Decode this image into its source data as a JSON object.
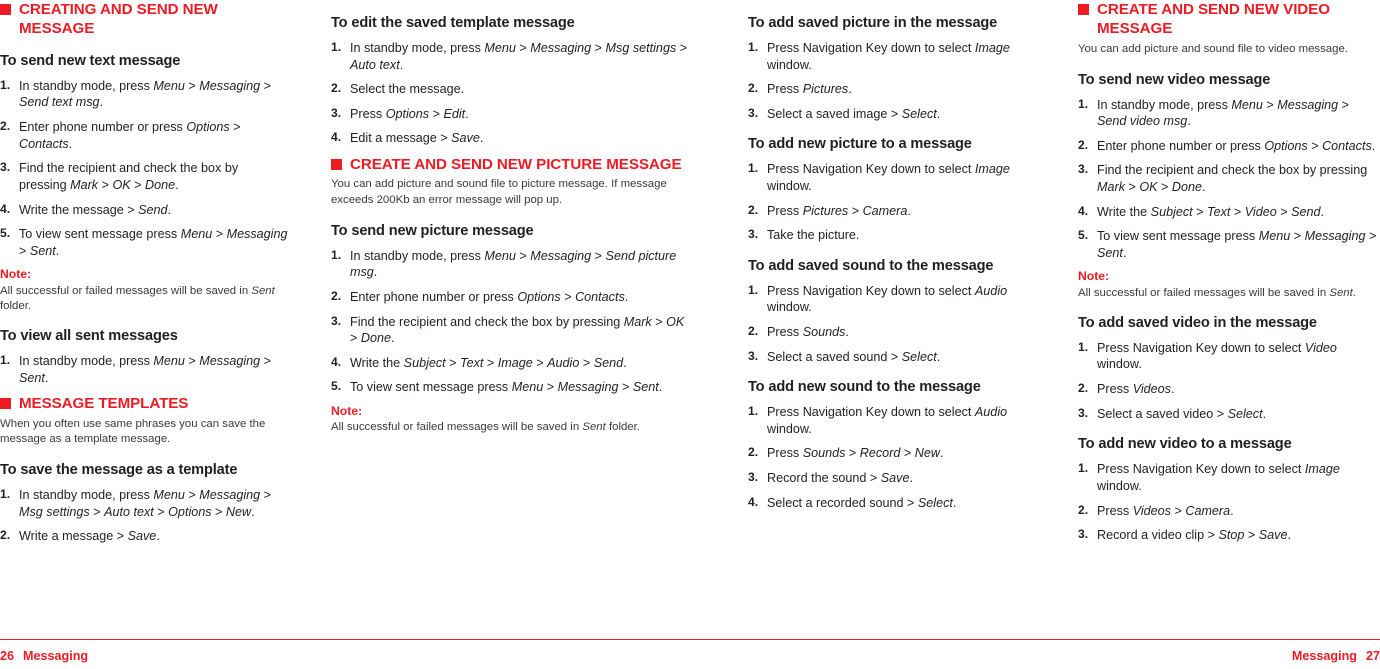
{
  "document": {
    "type": "mobile-phone-user-manual-spread",
    "accent_color": "#ec1c24",
    "text_color": "#231f20",
    "body_color": "#3a3a3c"
  },
  "footer": {
    "left_page_number": "26",
    "left_section": "Messaging",
    "right_section": "Messaging",
    "right_page_number": "27"
  },
  "columns": [
    {
      "id": "column-1",
      "blocks": [
        {
          "kind": "section-heading",
          "text": "CREATING AND SEND NEW MESSAGE"
        },
        {
          "kind": "sub-heading",
          "text": "To send new text message"
        },
        {
          "kind": "steps",
          "items": [
            "In standby mode, press <i>Menu</i> > <i>Messaging</i> > <i>Send text msg</i>.",
            "Enter phone number or press <i>Options</i> > <i>Contacts</i>.",
            "Find the recipient and check the box by pressing <i>Mark</i> > <i>OK</i> > <i>Done</i>.",
            "Write the message > <i>Send</i>.",
            "To view sent message press <i>Menu</i> > <i>Messaging</i> > <i>Sent</i>."
          ]
        },
        {
          "kind": "note",
          "label": "Note:",
          "body": "All successful or failed messages will be saved in <i>Sent</i> folder."
        },
        {
          "kind": "sub-heading",
          "text": "To view all sent messages"
        },
        {
          "kind": "steps",
          "items": [
            "In standby mode, press <i>Menu</i> > <i>Messaging</i> > <i>Sent</i>."
          ]
        },
        {
          "kind": "section-heading",
          "text": "MESSAGE TEMPLATES"
        },
        {
          "kind": "paragraph",
          "text": "When you often use same phrases you can save the message as a template message."
        },
        {
          "kind": "sub-heading",
          "text": "To save the message as a template"
        },
        {
          "kind": "steps",
          "items": [
            "In standby mode, press <i>Menu</i> > <i>Messaging</i> > <i>Msg settings</i> > <i>Auto text</i> > <i>Options</i> > <i>New</i>.",
            "Write a message > <i>Save</i>."
          ]
        }
      ]
    },
    {
      "id": "column-2",
      "blocks": [
        {
          "kind": "sub-heading",
          "text": "To edit the saved template message"
        },
        {
          "kind": "steps",
          "items": [
            "In standby mode, press <i>Menu</i> > <i>Messaging</i> > <i>Msg settings</i> > <i>Auto text</i>.",
            "Select the message.",
            "Press <i>Options</i> > <i>Edit</i>.",
            "Edit a message > <i>Save</i>."
          ]
        },
        {
          "kind": "section-heading",
          "text": "CREATE AND SEND NEW PICTURE MESSAGE"
        },
        {
          "kind": "paragraph",
          "text": "You can add picture and sound file to picture message. If message exceeds 200Kb an error message will pop up."
        },
        {
          "kind": "sub-heading",
          "text": "To send new picture message"
        },
        {
          "kind": "steps",
          "items": [
            "In standby mode, press <i>Menu</i> > <i>Messaging</i> > <i>Send picture msg</i>.",
            "Enter phone number or press <i>Options</i> > <i>Contacts</i>.",
            "Find the recipient and check the box by pressing <i>Mark</i> > <i>OK</i> > <i>Done</i>.",
            "Write the <i>Subject</i> > <i>Text</i> > <i>Image</i> > <i>Audio</i> > <i>Send</i>.",
            "To view sent message press <i>Menu</i> > <i>Messaging</i> > <i>Sent</i>."
          ]
        },
        {
          "kind": "note",
          "label": "Note:",
          "body": "All successful or failed messages will be saved in <i>Sent</i> folder."
        }
      ]
    },
    {
      "id": "column-3",
      "blocks": [
        {
          "kind": "sub-heading",
          "text": "To add saved picture in the message"
        },
        {
          "kind": "steps",
          "items": [
            "Press Navigation Key down to select <i>Image</i> window.",
            "Press <i>Pictures</i>.",
            "Select a saved image > <i>Select</i>."
          ]
        },
        {
          "kind": "sub-heading",
          "text": "To add new picture to a message"
        },
        {
          "kind": "steps",
          "items": [
            "Press Navigation Key down to select <i>Image</i> window.",
            "Press <i>Pictures</i> > <i>Camera</i>.",
            "Take the picture."
          ]
        },
        {
          "kind": "sub-heading",
          "text": "To add saved sound to the message"
        },
        {
          "kind": "steps",
          "items": [
            "Press Navigation Key down to select <i>Audio</i> window.",
            "Press <i>Sounds</i>.",
            "Select a saved sound > <i>Select</i>."
          ]
        },
        {
          "kind": "sub-heading",
          "text": "To add new sound to the message"
        },
        {
          "kind": "steps",
          "items": [
            "Press Navigation Key down to select <i>Audio</i> window.",
            "Press <i>Sounds</i> > <i>Record</i> > <i>New</i>.",
            "Record the sound > <i>Save</i>.",
            "Select a recorded sound > <i>Select</i>."
          ]
        }
      ]
    },
    {
      "id": "column-4",
      "blocks": [
        {
          "kind": "section-heading",
          "text": "CREATE AND SEND NEW VIDEO MESSAGE"
        },
        {
          "kind": "paragraph",
          "text": "You can add picture and sound file to video message."
        },
        {
          "kind": "sub-heading",
          "text": "To send new video message"
        },
        {
          "kind": "steps",
          "items": [
            "In standby mode, press <i>Menu</i> > <i>Messaging</i> > <i>Send video msg</i>.",
            "Enter phone number or press <i>Options</i> > <i>Contacts</i>.",
            "Find the recipient and check the box by pressing <i>Mark</i> > <i>OK</i> > <i>Done</i>.",
            "Write the <i>Subject</i> > <i>Text</i> > <i>Video</i> > <i>Send</i>.",
            "To view sent message press <i>Menu</i> > <i>Messaging</i> > <i>Sent</i>."
          ]
        },
        {
          "kind": "note",
          "label": "Note:",
          "body": "All successful or failed messages will be saved in <i>Sent</i>."
        },
        {
          "kind": "sub-heading",
          "text": "To add saved video in the message"
        },
        {
          "kind": "steps",
          "items": [
            "Press Navigation Key down to select <i>Video</i> window.",
            "Press <i>Videos</i>.",
            "Select a saved video > <i>Select</i>."
          ]
        },
        {
          "kind": "sub-heading",
          "text": "To add new video to a message"
        },
        {
          "kind": "steps",
          "items": [
            "Press Navigation Key down to select <i>Image</i> window.",
            "Press <i>Videos</i> > <i>Camera</i>.",
            "Record a video clip > <i>Stop</i> > <i>Save</i>."
          ]
        }
      ]
    }
  ]
}
